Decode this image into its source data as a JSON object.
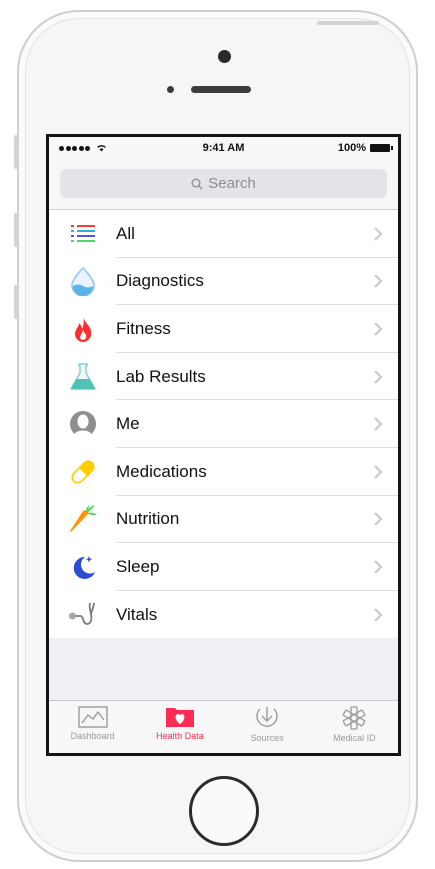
{
  "status_bar": {
    "time": "9:41 AM",
    "battery": "100%"
  },
  "search": {
    "placeholder": "Search"
  },
  "categories": [
    {
      "label": "All",
      "icon": "all-list-icon"
    },
    {
      "label": "Diagnostics",
      "icon": "drop-icon"
    },
    {
      "label": "Fitness",
      "icon": "flame-icon"
    },
    {
      "label": "Lab Results",
      "icon": "flask-icon"
    },
    {
      "label": "Me",
      "icon": "person-icon"
    },
    {
      "label": "Medications",
      "icon": "pill-icon"
    },
    {
      "label": "Nutrition",
      "icon": "carrot-icon"
    },
    {
      "label": "Sleep",
      "icon": "moon-icon"
    },
    {
      "label": "Vitals",
      "icon": "stethoscope-icon"
    }
  ],
  "tab_bar": {
    "tabs": [
      {
        "label": "Dashboard",
        "icon": "dashboard-icon",
        "active": false
      },
      {
        "label": "Health Data",
        "icon": "health-data-icon",
        "active": true
      },
      {
        "label": "Sources",
        "icon": "sources-icon",
        "active": false
      },
      {
        "label": "Medical ID",
        "icon": "medical-id-icon",
        "active": false
      }
    ]
  },
  "colors": {
    "accent": "#ff2d55",
    "tab_inactive": "#9a9a9f",
    "chevron": "#c7c7cc"
  }
}
